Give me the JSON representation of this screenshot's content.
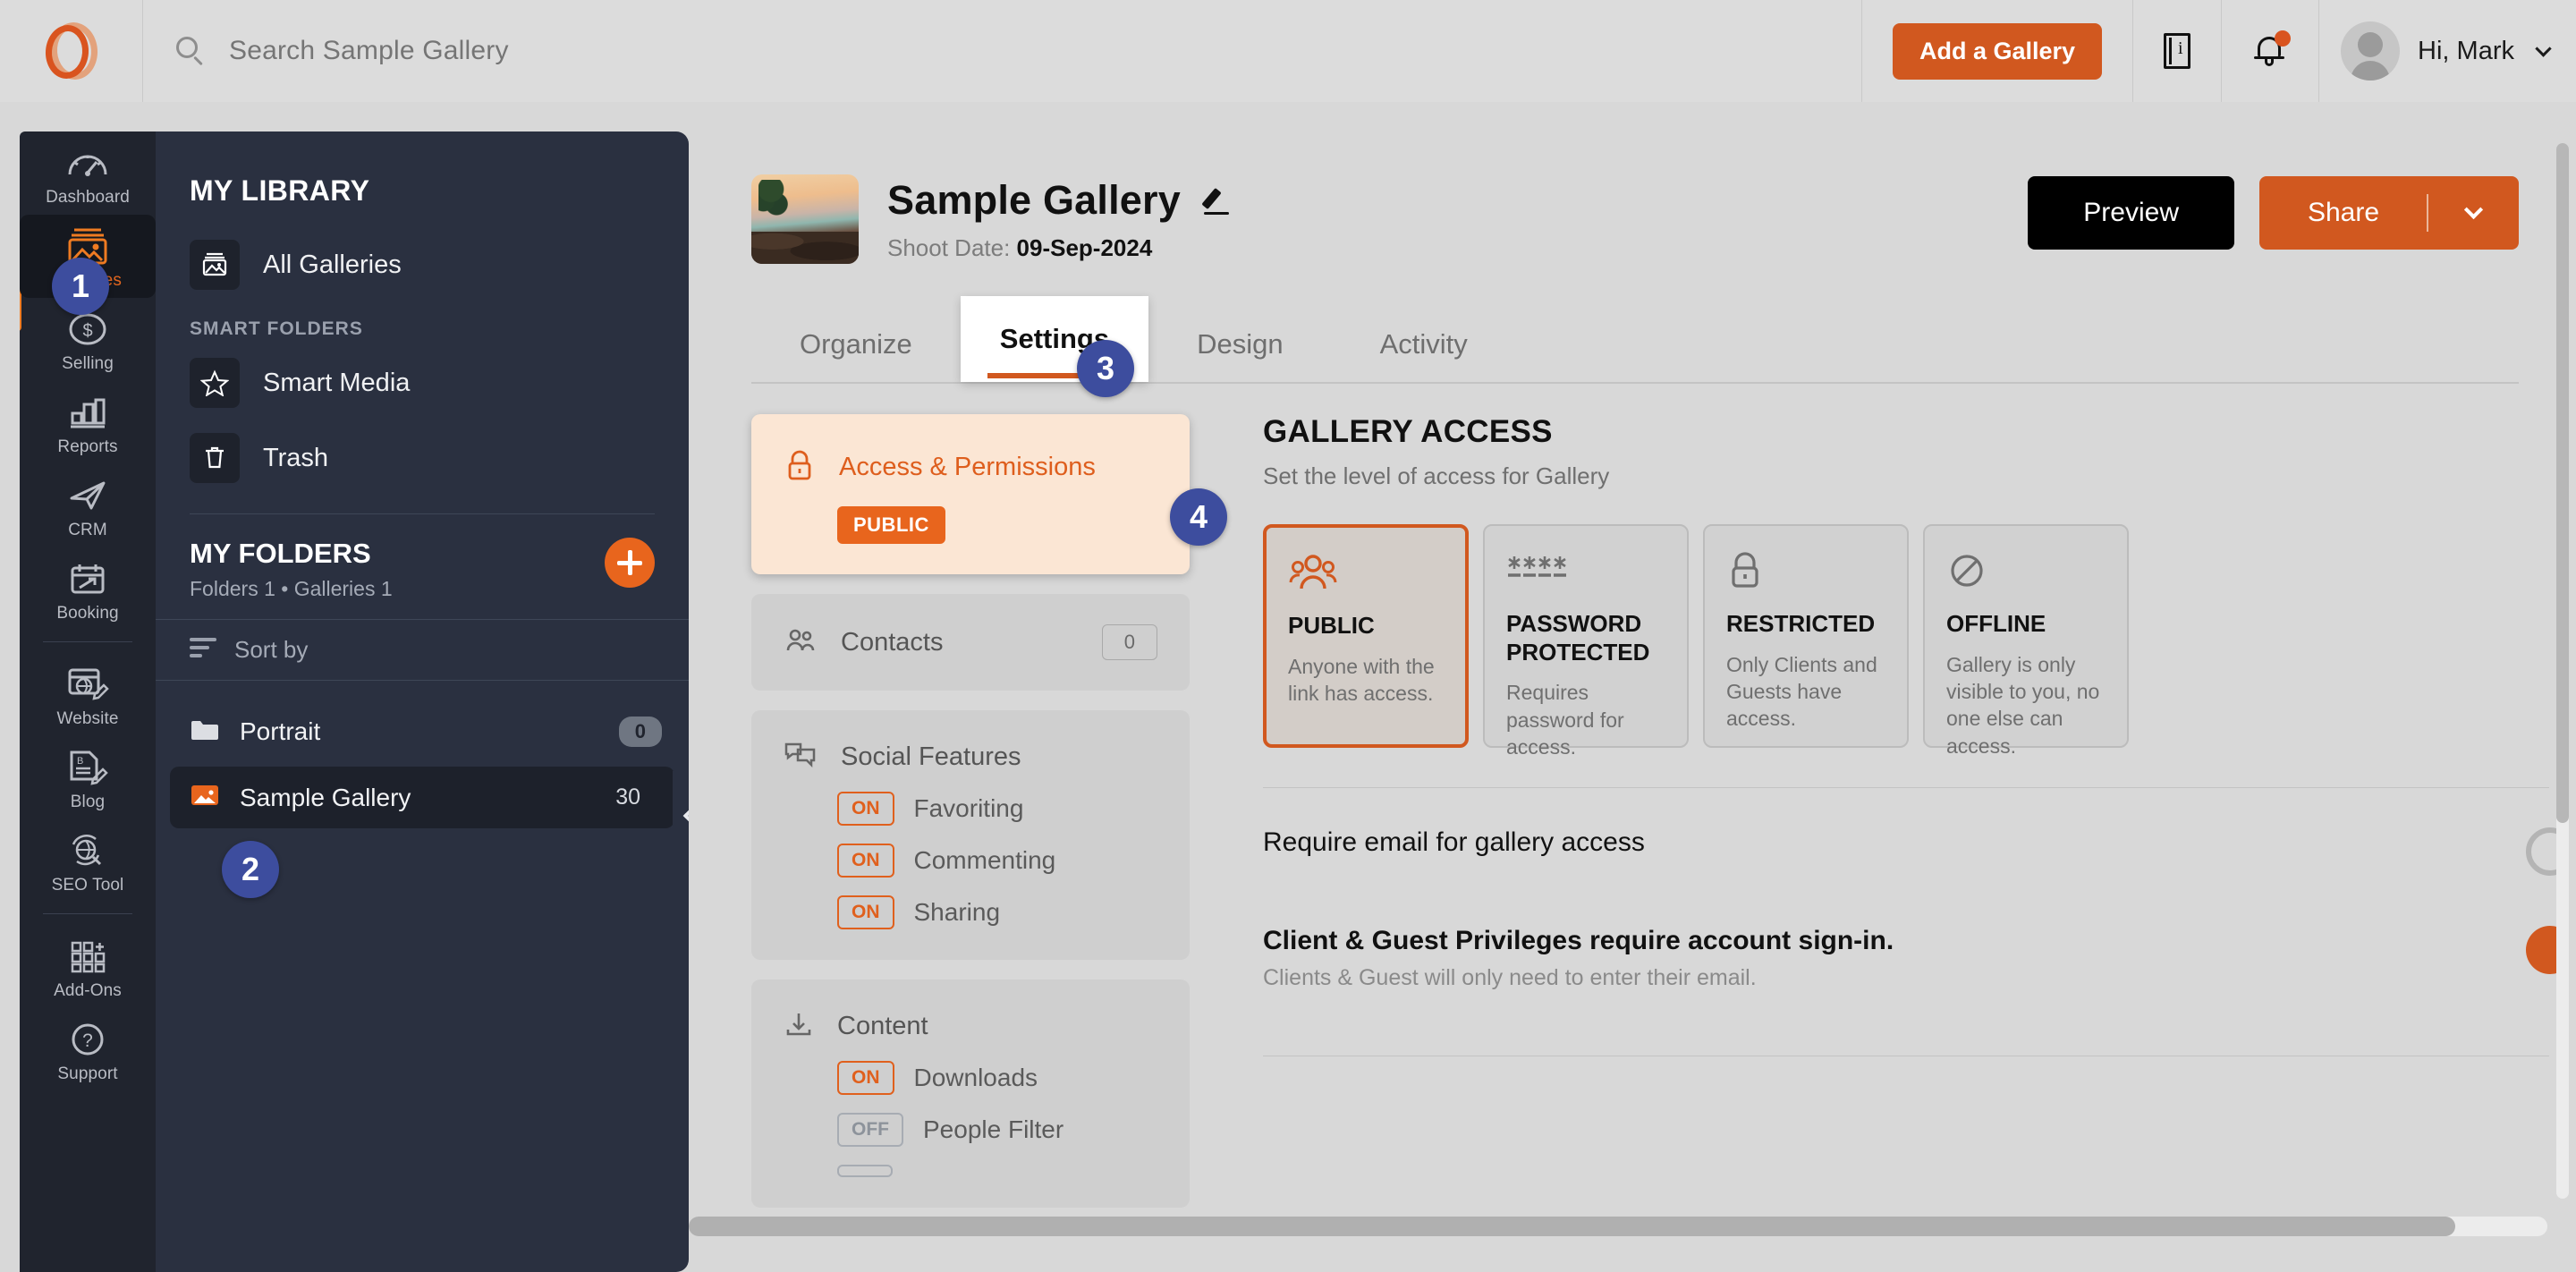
{
  "topbar": {
    "logo_name": "brand-logo",
    "search_placeholder": "Search Sample Gallery",
    "search_value": "",
    "add_gallery_label": "Add a Gallery",
    "guide_icon": "book-guide-icon",
    "notifications_icon": "bell-icon",
    "user_greeting": "Hi, Mark"
  },
  "rail": {
    "items": [
      {
        "label": "Dashboard",
        "icon": "speedometer-icon"
      },
      {
        "label": "Galleries",
        "icon": "image-stack-icon",
        "active": true
      },
      {
        "label": "Selling",
        "icon": "dollar-circle-icon"
      },
      {
        "label": "Reports",
        "icon": "bar-chart-icon"
      },
      {
        "label": "CRM",
        "icon": "paper-plane-icon"
      },
      {
        "label": "Booking",
        "icon": "calendar-arrow-icon"
      },
      {
        "label": "Website",
        "icon": "website-edit-icon"
      },
      {
        "label": "Blog",
        "icon": "blog-edit-icon"
      },
      {
        "label": "SEO Tool",
        "icon": "seo-globe-icon"
      },
      {
        "label": "Add-Ons",
        "icon": "grid-plus-icon"
      },
      {
        "label": "Support",
        "icon": "question-circle-icon"
      }
    ]
  },
  "library": {
    "title": "MY LIBRARY",
    "all_galleries": {
      "label": "All Galleries",
      "icon": "image-icon"
    },
    "smart_folders_heading": "SMART FOLDERS",
    "smart_folders": [
      {
        "label": "Smart Media",
        "icon": "star-icon"
      },
      {
        "label": "Trash",
        "icon": "trash-icon"
      }
    ],
    "folders_title": "MY FOLDERS",
    "folders_sub": "Folders 1 • Galleries 1",
    "add_folder_icon": "plus-circle-icon",
    "sort_by_label": "Sort by",
    "rows": [
      {
        "label": "Portrait",
        "count": "0",
        "type": "folder",
        "icon": "folder-icon"
      },
      {
        "label": "Sample Gallery",
        "count": "30",
        "type": "gallery",
        "icon": "gallery-thumb-icon",
        "selected": true
      }
    ],
    "collapse_icon": "chevron-left-icon"
  },
  "gallery": {
    "thumb_name": "gallery-cover-thumbnail",
    "title": "Sample Gallery",
    "edit_icon": "pencil-icon",
    "shoot_date_label": "Shoot Date:",
    "shoot_date_value": "09-Sep-2024",
    "preview_label": "Preview",
    "share_label": "Share",
    "share_caret_icon": "chevron-down-icon"
  },
  "tabs": [
    {
      "label": "Organize",
      "active": false
    },
    {
      "label": "Settings",
      "active": true
    },
    {
      "label": "Design",
      "active": false
    },
    {
      "label": "Activity",
      "active": false
    }
  ],
  "settings_menu": {
    "access": {
      "label": "Access & Permissions",
      "icon": "lock-icon",
      "badge": "PUBLIC",
      "active": true
    },
    "contacts": {
      "label": "Contacts",
      "icon": "contacts-icon",
      "count": "0"
    },
    "social": {
      "label": "Social Features",
      "icon": "chat-bubbles-icon",
      "toggles": [
        {
          "state": "ON",
          "label": "Favoriting"
        },
        {
          "state": "ON",
          "label": "Commenting"
        },
        {
          "state": "ON",
          "label": "Sharing"
        }
      ]
    },
    "content": {
      "label": "Content",
      "icon": "download-icon",
      "toggles": [
        {
          "state": "ON",
          "label": "Downloads"
        },
        {
          "state": "OFF",
          "label": "People Filter"
        }
      ]
    }
  },
  "access_pane": {
    "title": "GALLERY ACCESS",
    "subtitle": "Set the level of access for Gallery",
    "cards": [
      {
        "name": "PUBLIC",
        "desc": "Anyone with the link has access.",
        "icon": "people-group-icon",
        "selected": true
      },
      {
        "name": "PASSWORD PROTECTED",
        "desc": "Requires password for access.",
        "icon": "asterisks-icon",
        "selected": false
      },
      {
        "name": "RESTRICTED",
        "desc": "Only Clients and Guests have access.",
        "icon": "lock-icon",
        "selected": false
      },
      {
        "name": "OFFLINE",
        "desc": "Gallery is only visible to you, no one else can access.",
        "icon": "no-entry-icon",
        "selected": false
      }
    ],
    "require_email": {
      "title": "Require email for gallery access",
      "state": "off"
    },
    "privileges": {
      "title": "Client & Guest Privileges require account sign-in.",
      "note": "Clients & Guest will only need to enter their email.",
      "state": "on"
    }
  },
  "steps": [
    {
      "n": "1"
    },
    {
      "n": "2"
    },
    {
      "n": "3"
    },
    {
      "n": "4"
    }
  ],
  "colors": {
    "accent": "#d1581f",
    "accent_bright": "#e8651d",
    "sidebar_dark": "#2a3040",
    "rail_dark": "#20242e",
    "step_badge": "#3d4d9e"
  }
}
